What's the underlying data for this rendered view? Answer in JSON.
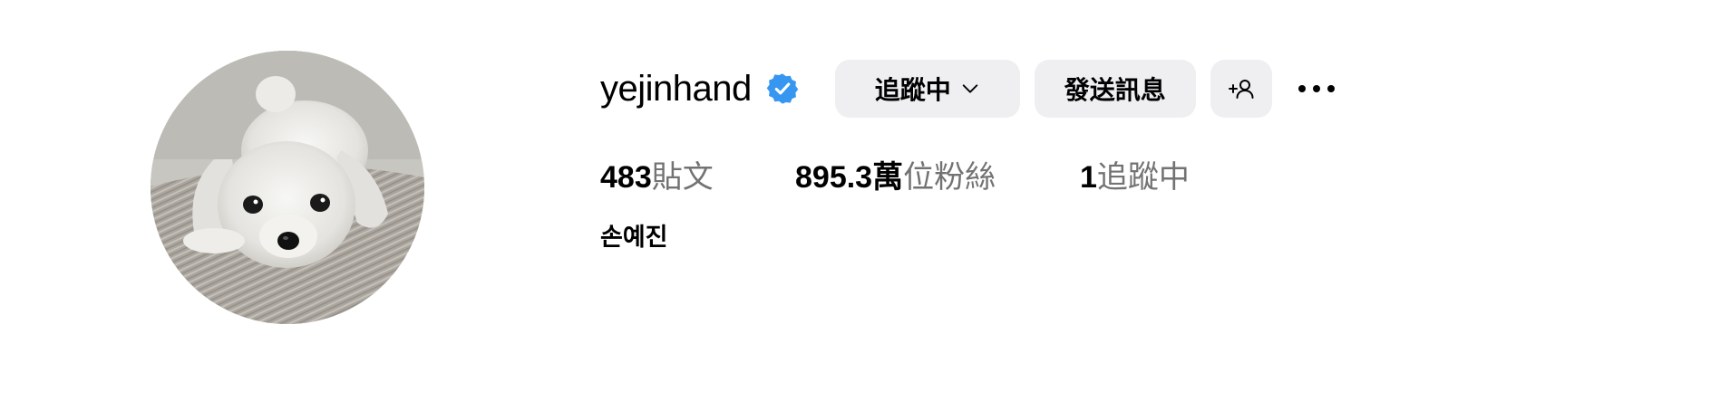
{
  "profile": {
    "username": "yejinhand",
    "verified": true,
    "full_name": "손예진",
    "avatar_description": "white fluffy dog lying on beige fabric"
  },
  "actions": {
    "following_label": "追蹤中",
    "message_label": "發送訊息",
    "add_user_icon": "person-plus-icon",
    "more_icon": "more-horizontal-icon"
  },
  "stats": {
    "posts": {
      "value": "483",
      "label": "貼文"
    },
    "followers": {
      "value": "895.3萬",
      "label": "位粉絲"
    },
    "following": {
      "value": "1",
      "label": "追蹤中"
    }
  },
  "colors": {
    "verified_badge": "#3797f0",
    "button_bg": "#efeff2",
    "secondary_text": "#737373"
  }
}
